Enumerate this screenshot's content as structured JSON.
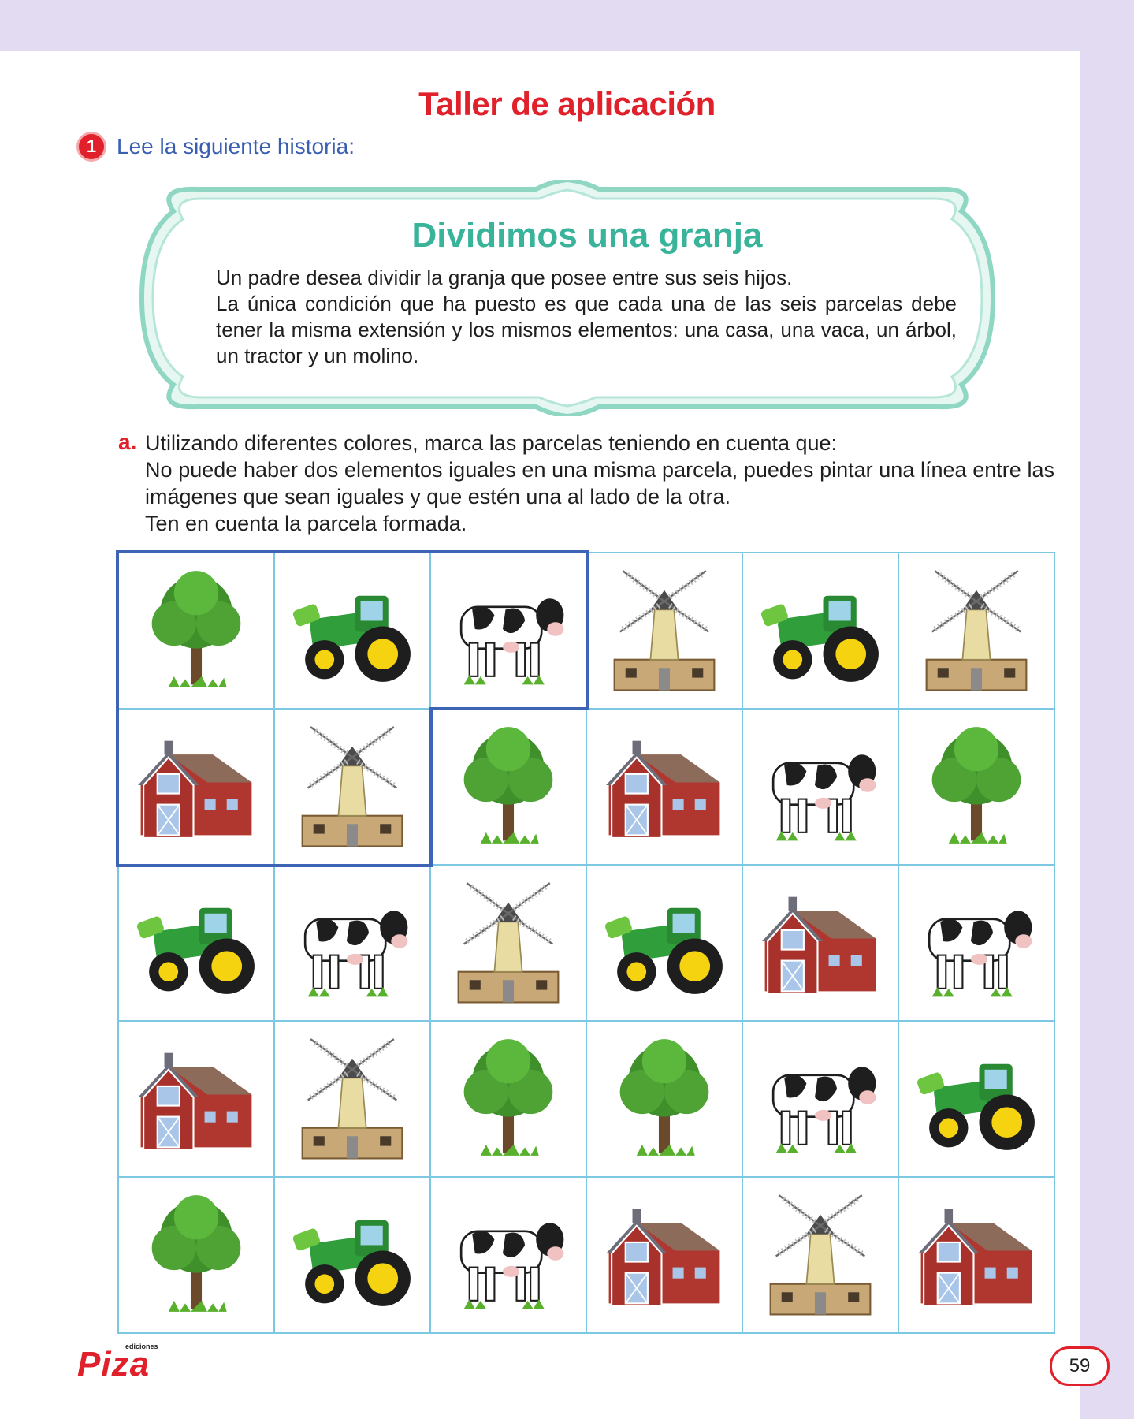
{
  "header": {
    "title": "Taller de aplicación",
    "step_number": "1",
    "step_text": "Lee la siguiente historia:"
  },
  "story": {
    "title": "Dividimos una granja",
    "paragraphs": [
      "Un padre desea dividir la granja que posee entre sus seis hijos.",
      "La única condición que ha puesto es que cada una de las seis parcelas debe tener la misma extensión y los mismos elementos: una casa, una vaca, un árbol, un tractor y un molino."
    ]
  },
  "question": {
    "letter": "a.",
    "lines": [
      "Utilizando diferentes colores, marca las parcelas teniendo en cuenta que:",
      "No puede haber dos elementos iguales en una misma parcela, puedes pintar una línea entre las imágenes que sean iguales y que estén una al lado de la otra.",
      "Ten en cuenta la parcela formada."
    ]
  },
  "grid": {
    "rows": [
      [
        "tree",
        "tractor",
        "cow",
        "windmill",
        "tractor",
        "windmill"
      ],
      [
        "barn",
        "windmill",
        "tree",
        "barn",
        "cow",
        "tree"
      ],
      [
        "tractor",
        "cow",
        "windmill",
        "tractor",
        "barn",
        "cow"
      ],
      [
        "barn",
        "windmill",
        "tree",
        "tree",
        "cow",
        "tractor"
      ],
      [
        "tree",
        "tractor",
        "cow",
        "barn",
        "windmill",
        "barn"
      ]
    ],
    "example_parcel": [
      [
        0,
        0
      ],
      [
        0,
        1
      ],
      [
        0,
        2
      ],
      [
        1,
        0
      ],
      [
        1,
        1
      ]
    ],
    "colors": {
      "grid_line": "#7cc7e2",
      "parcel_outline": "#3e64b5"
    }
  },
  "footer": {
    "logo_small": "ediciones",
    "logo": "Piza",
    "page_number": "59"
  },
  "colors": {
    "accent_red": "#e0202a",
    "teal": "#39b49b",
    "blue_text": "#3a5fb0",
    "band": "#e3dbf1"
  }
}
